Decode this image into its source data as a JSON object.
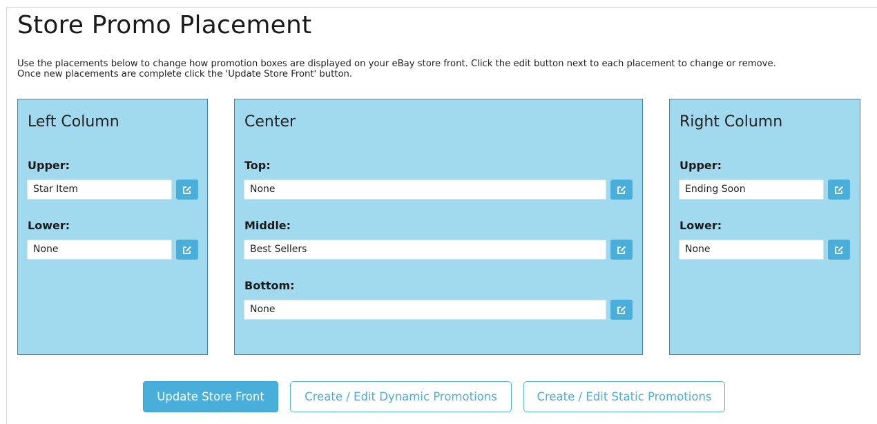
{
  "page": {
    "title": "Store Promo Placement",
    "intro_line1": "Use the placements below to change how promotion boxes are displayed on your eBay store front. Click the edit button next to each placement to change or remove.",
    "intro_line2": "Once new placements are complete click the 'Update Store Front' button."
  },
  "panels": {
    "left": {
      "title": "Left Column",
      "slots": [
        {
          "label": "Upper:",
          "value": "Star Item"
        },
        {
          "label": "Lower:",
          "value": "None"
        }
      ]
    },
    "center": {
      "title": "Center",
      "slots": [
        {
          "label": "Top:",
          "value": "None"
        },
        {
          "label": "Middle:",
          "value": "Best Sellers"
        },
        {
          "label": "Bottom:",
          "value": "None"
        }
      ]
    },
    "right": {
      "title": "Right Column",
      "slots": [
        {
          "label": "Upper:",
          "value": "Ending Soon"
        },
        {
          "label": "Lower:",
          "value": "None"
        }
      ]
    }
  },
  "actions": {
    "update_label": "Update Store Front",
    "dynamic_label": "Create / Edit Dynamic Promotions",
    "static_label": "Create / Edit Static Promotions"
  },
  "icons": {
    "edit": "edit-icon"
  },
  "colors": {
    "panel_bg": "#a1d9ee",
    "panel_border": "#3f7dd8",
    "accent": "#4aaedb"
  }
}
